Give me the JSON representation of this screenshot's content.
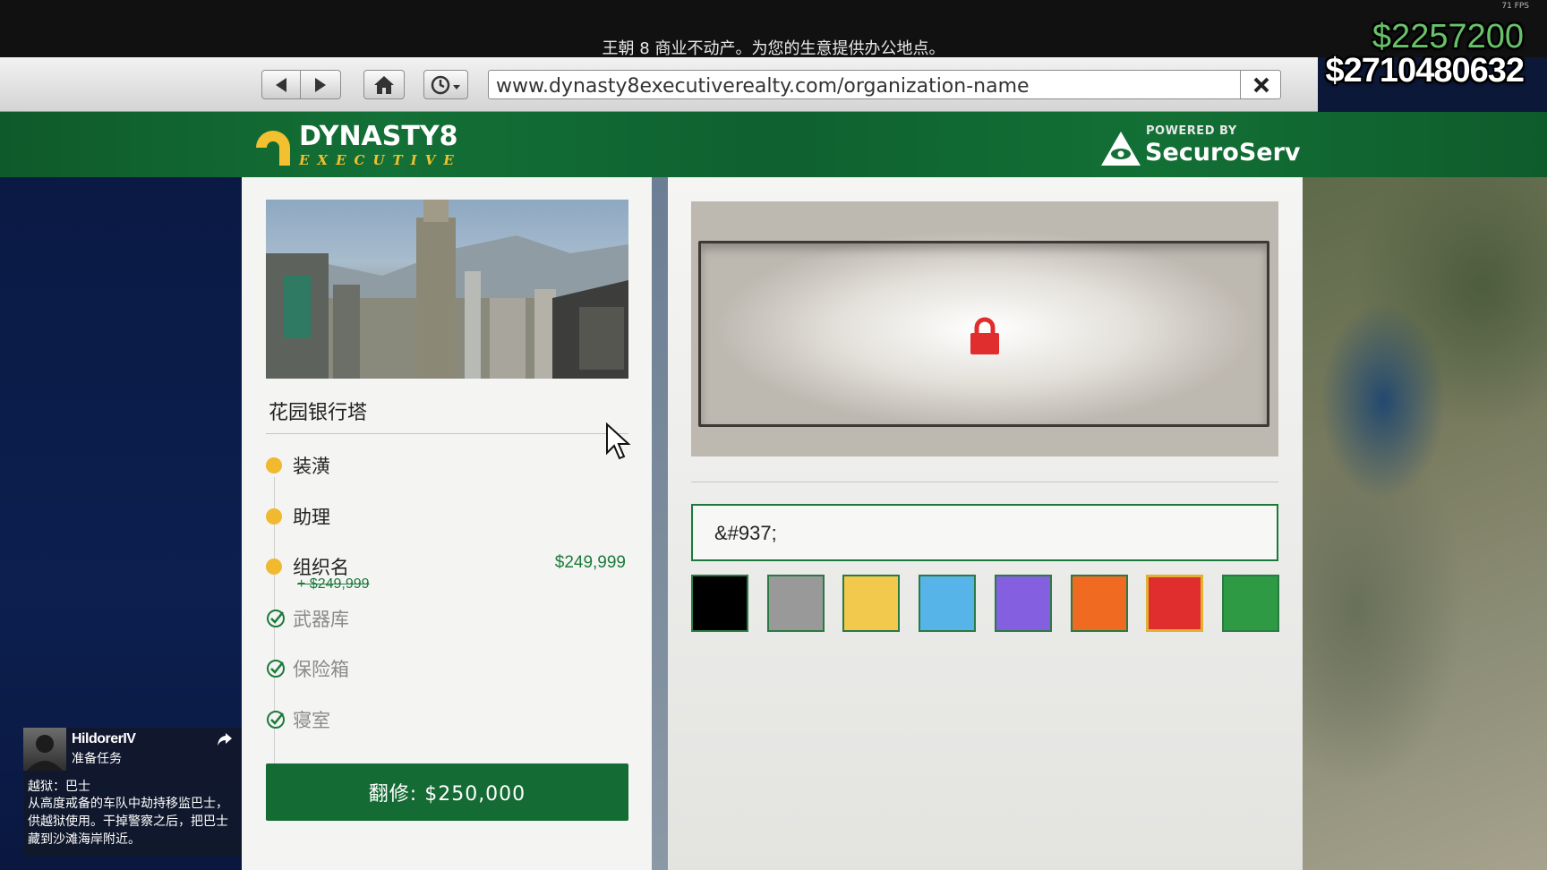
{
  "hud": {
    "fps": "71 FPS",
    "cash": "$2257200",
    "bank": "$2710480632"
  },
  "page_title": "王朝 8 商业不动产。为您的生意提供办公地点。",
  "browser": {
    "url": "www.dynasty8executiverealty.com/organization-name",
    "back_icon": "back-arrow-icon",
    "forward_icon": "forward-arrow-icon",
    "home_icon": "home-icon",
    "history_icon": "clock-icon",
    "close_icon": "close-icon"
  },
  "header": {
    "logo_line1": "DYNASTY8",
    "logo_line2": "EXECUTIVE",
    "powered_by": "POWERED BY",
    "partner": "SecuroServ"
  },
  "property": {
    "name": "花园银行塔",
    "options": [
      {
        "label": "装潢",
        "state": "available"
      },
      {
        "label": "助理",
        "state": "available"
      },
      {
        "label": "组织名",
        "state": "available",
        "price": "$249,999",
        "old_price": "+ $249,999"
      },
      {
        "label": "武器库",
        "state": "owned"
      },
      {
        "label": "保险箱",
        "state": "owned"
      },
      {
        "label": "寝室",
        "state": "owned"
      }
    ],
    "renovate_button": "翻修: $250,000"
  },
  "organization": {
    "name_value": "&#937;",
    "selected_color_index": 6,
    "colors": [
      "#000000",
      "#999999",
      "#f2c94c",
      "#56b4e9",
      "#8460e0",
      "#f06a22",
      "#e02d2d",
      "#2e9b44"
    ]
  },
  "notification": {
    "sender": "HildorerIV",
    "subject": "准备任务",
    "title": "越狱：巴士",
    "body": "从高度戒备的车队中劫持移监巴士，供越狱使用。干掉警察之后，把巴士藏到沙滩海岸附近。"
  },
  "colors": {
    "header_green": "#137036",
    "button_green": "#146b34",
    "price_green": "#1b7a3b",
    "bullet_yellow": "#f0b92e",
    "lock_red": "#e02d2d"
  }
}
